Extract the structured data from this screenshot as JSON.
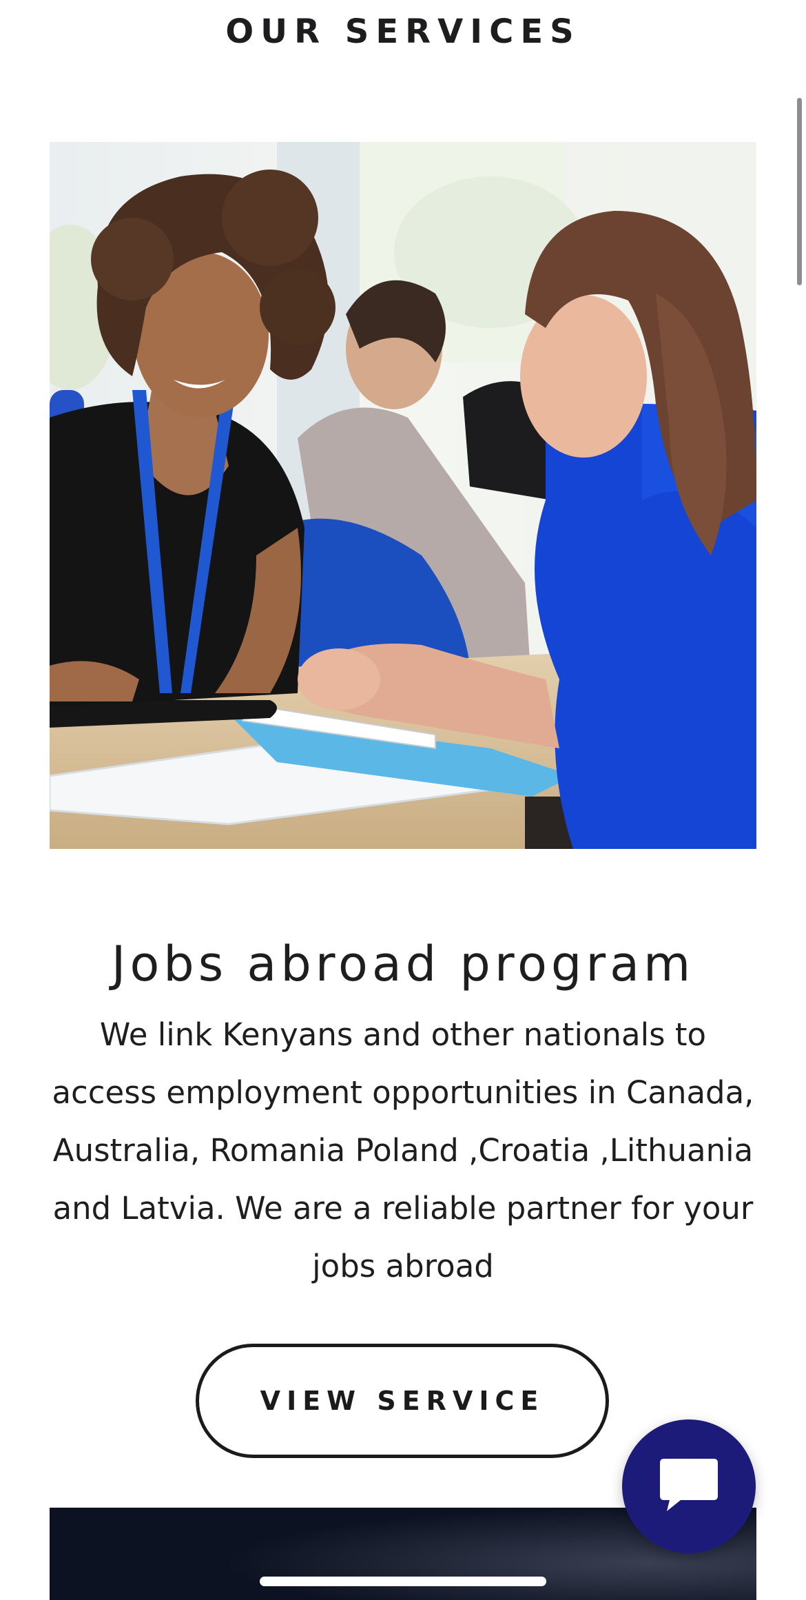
{
  "section": {
    "title": "OUR SERVICES"
  },
  "service": {
    "image_alt": "Recruitment consultant meeting with a job applicant at a desk",
    "title": "Jobs abroad program",
    "description": "We link Kenyans and other nationals to access employment opportunities in Canada, Australia, Romania Poland ,Croatia ,Lithuania and Latvia. We are a reliable partner for your jobs abroad",
    "button_label": "VIEW SERVICE"
  },
  "chat": {
    "icon": "chat-bubble-icon",
    "color": "#1d1b7a"
  },
  "colors": {
    "text": "#1e1e1e",
    "accent": "#1d1b7a",
    "next_card": "#0f1323"
  }
}
